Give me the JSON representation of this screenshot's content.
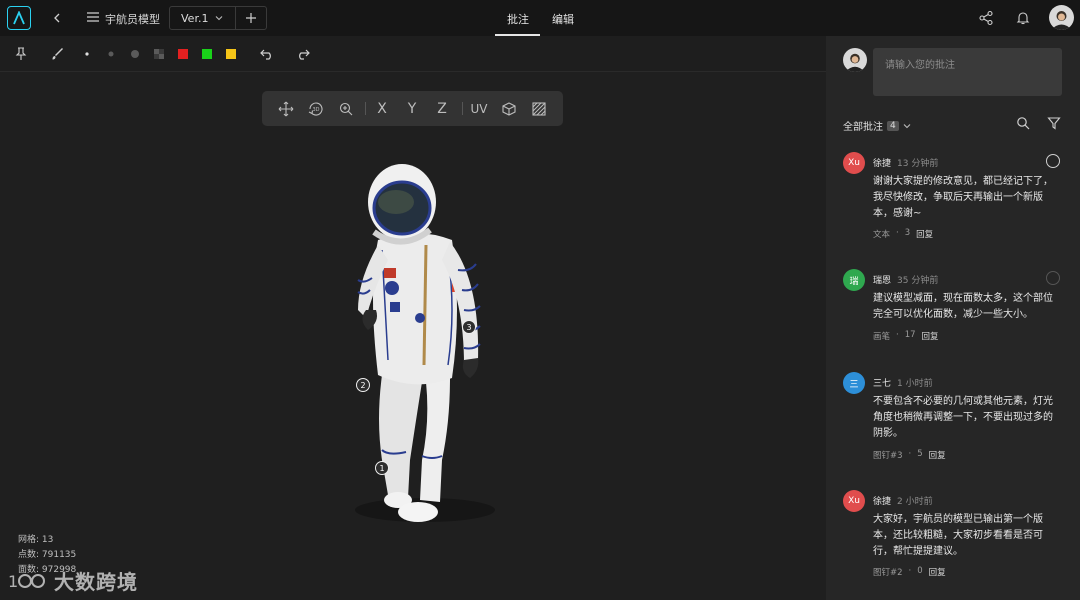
{
  "header": {
    "project_name": "宇航员模型",
    "version": "Ver.1",
    "tabs": [
      {
        "label": "批注",
        "active": true
      },
      {
        "label": "编辑",
        "active": false
      }
    ],
    "accent_color": "#2bd1f0"
  },
  "toolbar": {
    "colors": [
      "#e32020",
      "#19d219",
      "#f5c518"
    ],
    "tools": [
      "pin-icon",
      "brush-icon",
      "dot-small",
      "dot-medium",
      "dot-large",
      "eraser-icon",
      "undo-icon",
      "redo-icon"
    ]
  },
  "view_toolbar": {
    "axis_x": "X",
    "axis_y": "Y",
    "axis_z": "Z",
    "uv": "UV",
    "icons": [
      "move-icon",
      "rotate-3d-icon",
      "zoom-icon",
      "cube-icon",
      "texture-icon"
    ]
  },
  "model": {
    "pins": [
      "1",
      "2",
      "3"
    ]
  },
  "stats": {
    "mesh": "网格: 13",
    "vertices": "点数: 791135",
    "faces": "面数: 972998"
  },
  "watermark": "大数跨境",
  "panel": {
    "input_placeholder": "请输入您的批注",
    "filter_label": "全部批注",
    "count": "4",
    "comments": [
      {
        "avatar_text": "Xu",
        "avatar_color": "#e04d4d",
        "author": "徐捷",
        "time": "13 分钟前",
        "body": "谢谢大家提的修改意见，都已经记下了，我尽快修改，争取后天再输出一个新版本，感谢~",
        "tag": "文本",
        "replies": "3",
        "reply_label": "回复"
      },
      {
        "avatar_text": "瑞",
        "avatar_color": "#2fa84f",
        "author": "瑞恩",
        "time": "35 分钟前",
        "body": "建议模型减面，现在面数太多，这个部位完全可以优化面数，减少一些大小。",
        "tag": "画笔",
        "replies": "17",
        "reply_label": "回复"
      },
      {
        "avatar_text": "三",
        "avatar_color": "#2d8fd8",
        "author": "三七",
        "time": "1 小时前",
        "body": "不要包含不必要的几何或其他元素，灯光角度也稍微再调整一下，不要出现过多的阴影。",
        "tag": "图钉#3",
        "replies": "5",
        "reply_label": "回复"
      },
      {
        "avatar_text": "Xu",
        "avatar_color": "#e04d4d",
        "author": "徐捷",
        "time": "2 小时前",
        "body": "大家好，宇航员的模型已输出第一个版本，还比较粗糙，大家初步看看是否可行，帮忙提提建议。",
        "tag": "图钉#2",
        "replies": "0",
        "reply_label": "回复"
      }
    ]
  }
}
